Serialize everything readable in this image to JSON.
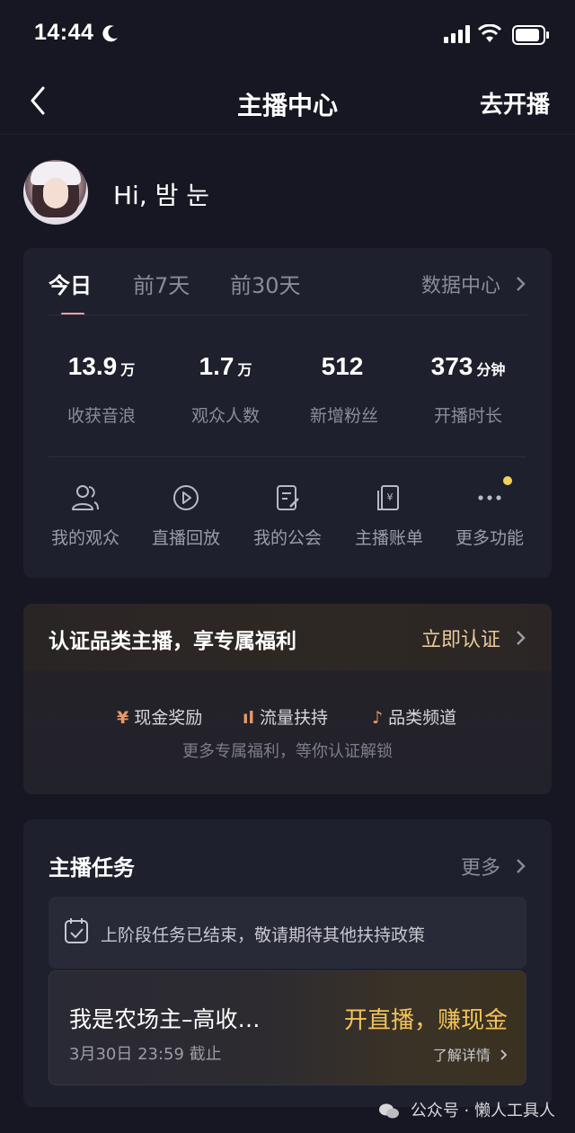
{
  "status_bar": {
    "time": "14:44"
  },
  "nav": {
    "title": "主播中心",
    "action": "去开播"
  },
  "profile": {
    "greeting": "Hi, 밤 눈"
  },
  "stats": {
    "tabs": [
      "今日",
      "前7天",
      "前30天"
    ],
    "active_tab": "今日",
    "data_center": "数据中心",
    "items": [
      {
        "value": "13.9",
        "unit": "万",
        "label": "收获音浪"
      },
      {
        "value": "1.7",
        "unit": "万",
        "label": "观众人数"
      },
      {
        "value": "512",
        "unit": "",
        "label": "新增粉丝"
      },
      {
        "value": "373",
        "unit": "分钟",
        "label": "开播时长"
      }
    ],
    "tools": [
      {
        "label": "我的观众",
        "icon": "users-icon"
      },
      {
        "label": "直播回放",
        "icon": "play-circle-icon"
      },
      {
        "label": "我的公会",
        "icon": "document-edit-icon"
      },
      {
        "label": "主播账单",
        "icon": "bill-icon"
      },
      {
        "label": "更多功能",
        "icon": "more-dots-icon"
      }
    ]
  },
  "certification": {
    "title": "认证品类主播，享专属福利",
    "action": "立即认证",
    "perks": [
      {
        "icon": "¥",
        "label": "现金奖励"
      },
      {
        "icon": "ıl",
        "label": "流量扶持"
      },
      {
        "icon": "♪",
        "label": "品类频道"
      }
    ],
    "subtitle": "更多专属福利，等你认证解锁"
  },
  "tasks": {
    "title": "主播任务",
    "more": "更多",
    "notice": "上阶段任务已结束，敬请期待其他扶持政策",
    "item": {
      "name": "我是农场主–高收…",
      "deadline": "3月30日 23:59 截止",
      "cta": "开直播，赚现金",
      "detail": "了解详情"
    }
  },
  "watermark": "公众号 · 懒人工具人",
  "colors": {
    "background": "#161722",
    "card": "#1f202d",
    "accent_gold": "#f2c35a",
    "tab_indicator": "#f5a0a8",
    "badge_dot": "#f2d15a"
  }
}
